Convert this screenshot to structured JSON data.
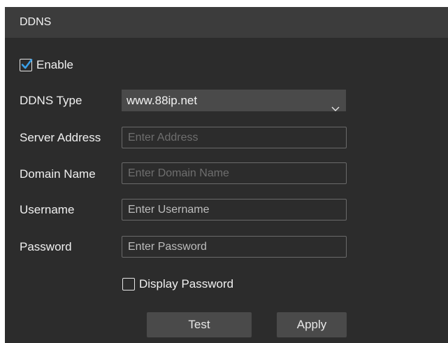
{
  "header": {
    "title": "DDNS"
  },
  "enable": {
    "label": "Enable",
    "checked": true
  },
  "ddns_type": {
    "label": "DDNS Type",
    "value": "www.88ip.net"
  },
  "server_address": {
    "label": "Server Address",
    "placeholder": "Enter Address",
    "value": ""
  },
  "domain_name": {
    "label": "Domain Name",
    "placeholder": "Enter Domain Name",
    "value": ""
  },
  "username": {
    "label": "Username",
    "placeholder": "Enter Username",
    "value": ""
  },
  "password": {
    "label": "Password",
    "placeholder": "Enter Password",
    "value": ""
  },
  "display_password": {
    "label": "Display Password",
    "checked": false
  },
  "buttons": {
    "test": "Test",
    "apply": "Apply"
  },
  "colors": {
    "panel_bg": "#2c2c2c",
    "header_bg": "#3c3c3c",
    "control_bg": "#4a4a4a",
    "check_accent": "#3aa0e8"
  }
}
